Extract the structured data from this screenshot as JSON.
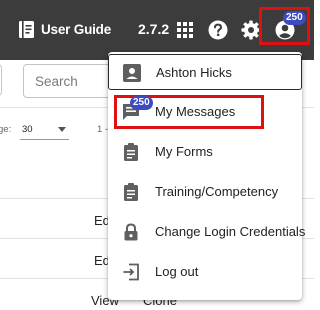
{
  "header": {
    "guide_label": "User Guide",
    "version": "2.7.2",
    "user_badge": "250"
  },
  "page": {
    "search_placeholder": "Search",
    "per_page_label": "ge:",
    "per_page_value": "30",
    "range_text": "1 -",
    "row_actions": [
      "Edi",
      "Edi",
      "View",
      "Clone"
    ]
  },
  "menu": {
    "items": [
      {
        "label": "Ashton Hicks",
        "icon": "account-box-icon"
      },
      {
        "label": "My Messages",
        "icon": "message-icon",
        "badge": "250"
      },
      {
        "label": "My Forms",
        "icon": "clipboard-icon"
      },
      {
        "label": "Training/Competency",
        "icon": "clipboard-icon"
      },
      {
        "label": "Change Login Credentials",
        "icon": "lock-icon"
      },
      {
        "label": "Log out",
        "icon": "logout-icon"
      }
    ]
  },
  "colors": {
    "topbar": "#3c3c3c",
    "highlight_border": "#e01010",
    "badge": "#3e4bc0",
    "icon_gray": "#5f5f5f"
  }
}
